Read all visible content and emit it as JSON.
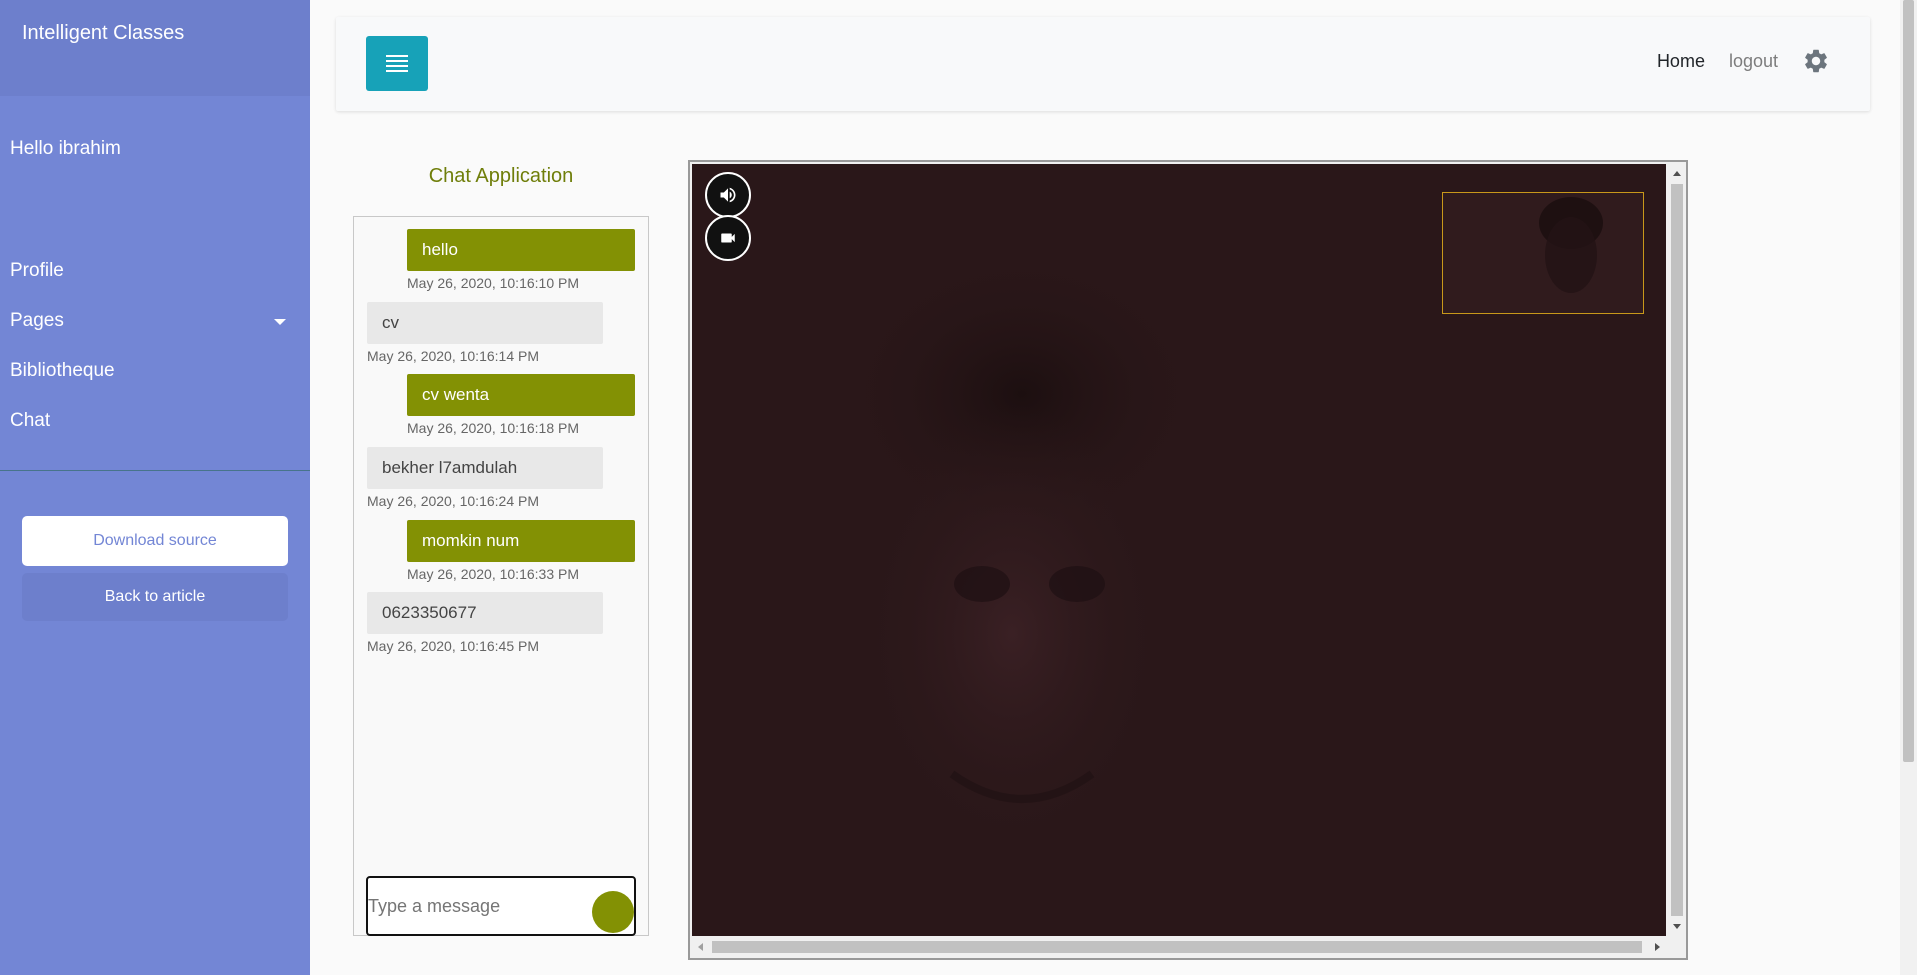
{
  "sidebar": {
    "brand": "Intelligent Classes",
    "greeting": "Hello ibrahim",
    "items": [
      {
        "label": "Profile"
      },
      {
        "label": "Pages"
      },
      {
        "label": "Bibliotheque"
      },
      {
        "label": "Chat"
      }
    ],
    "download_label": "Download source",
    "back_label": "Back to article"
  },
  "topbar": {
    "home_label": "Home",
    "logout_label": "logout"
  },
  "chat": {
    "title": "Chat Application",
    "messages": [
      {
        "direction": "out",
        "text": "hello",
        "time": "May 26, 2020, 10:16:10 PM"
      },
      {
        "direction": "in",
        "text": "cv",
        "time": "May 26, 2020, 10:16:14 PM"
      },
      {
        "direction": "out",
        "text": "cv wenta",
        "time": "May 26, 2020, 10:16:18 PM"
      },
      {
        "direction": "in",
        "text": "bekher l7amdulah",
        "time": "May 26, 2020, 10:16:24 PM"
      },
      {
        "direction": "out",
        "text": "momkin num",
        "time": "May 26, 2020, 10:16:33 PM"
      },
      {
        "direction": "in",
        "text": "0623350677",
        "time": "May 26, 2020, 10:16:45 PM"
      }
    ],
    "input_placeholder": "Type a message",
    "input_value": ""
  },
  "video": {
    "controls": [
      "speaker-icon",
      "camera-icon"
    ]
  },
  "colors": {
    "sidebar_bg": "#7386d5",
    "sidebar_header_bg": "#6d7fcc",
    "toggle_bg": "#17a2b8",
    "accent_olive": "#839104",
    "incoming_bubble": "#e8e8e8",
    "video_bg": "#2a1719",
    "pip_border": "#c8981a"
  }
}
